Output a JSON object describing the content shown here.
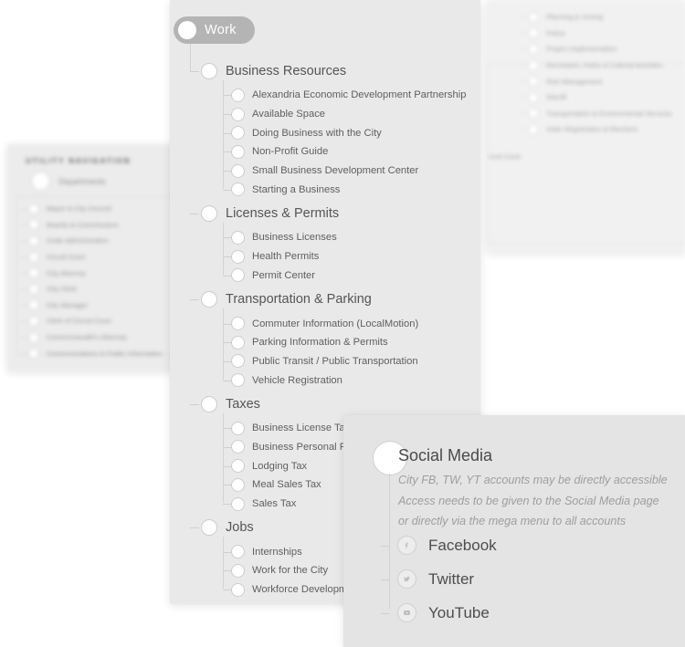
{
  "utility": {
    "title": "UTILITY NAVIGATION",
    "root_label": "Departments",
    "items": [
      "Mayor & City Council",
      "Boards & Commissions",
      "Code Administration",
      "Circuit Court",
      "City Attorney",
      "City Clerk",
      "City Manager",
      "Clerk of Circuit Court",
      "Commonwealth's Attorney",
      "Communications & Public Information"
    ]
  },
  "departments": {
    "partial_label": "rcuit Court",
    "items": [
      "Planning & Zoning",
      "Police",
      "Project Implementation",
      "Recreation, Parks & Cultural Activities",
      "Risk Management",
      "Sheriff",
      "Transportation & Environmental Services",
      "Voter Registration & Elections"
    ]
  },
  "work": {
    "root_label": "Work",
    "groups": [
      {
        "label": "Business Resources",
        "children": [
          "Alexandria Economic Development Partnership",
          "Available Space",
          "Doing Business with the City",
          "Non-Profit Guide",
          "Small Business Development Center",
          "Starting a Business"
        ]
      },
      {
        "label": "Licenses & Permits",
        "children": [
          "Business Licenses",
          "Health Permits",
          "Permit Center"
        ]
      },
      {
        "label": "Transportation & Parking",
        "children": [
          "Commuter Information (LocalMotion)",
          "Parking Information & Permits",
          "Public Transit / Public Transportation",
          "Vehicle Registration"
        ]
      },
      {
        "label": "Taxes",
        "children": [
          "Business License Tax",
          "Business Personal Property Tax",
          "Lodging Tax",
          "Meal Sales Tax",
          "Sales Tax"
        ]
      },
      {
        "label": "Jobs",
        "children": [
          "Internships",
          "Work for the City",
          "Workforce Development"
        ]
      }
    ]
  },
  "social": {
    "title": "Social Media",
    "notes": [
      "City FB, TW, YT accounts may be directly accessible",
      "Access needs to be given to the Social Media page",
      "or directly via the mega menu to all accounts"
    ],
    "links": [
      {
        "name": "Facebook",
        "icon": "facebook-icon"
      },
      {
        "name": "Twitter",
        "icon": "twitter-icon"
      },
      {
        "name": "YouTube",
        "icon": "youtube-icon"
      }
    ]
  },
  "colors": {
    "page_background": "#ffffff",
    "panel_background": "#e9e9e9",
    "pill_background": "#b4b4b4",
    "pill_text": "#ffffff",
    "node_fill": "#ffffff",
    "node_border": "#cdcdcd",
    "connector": "#d3d3d3",
    "primary_text": "#555555",
    "muted_text": "#9e9e9e"
  }
}
